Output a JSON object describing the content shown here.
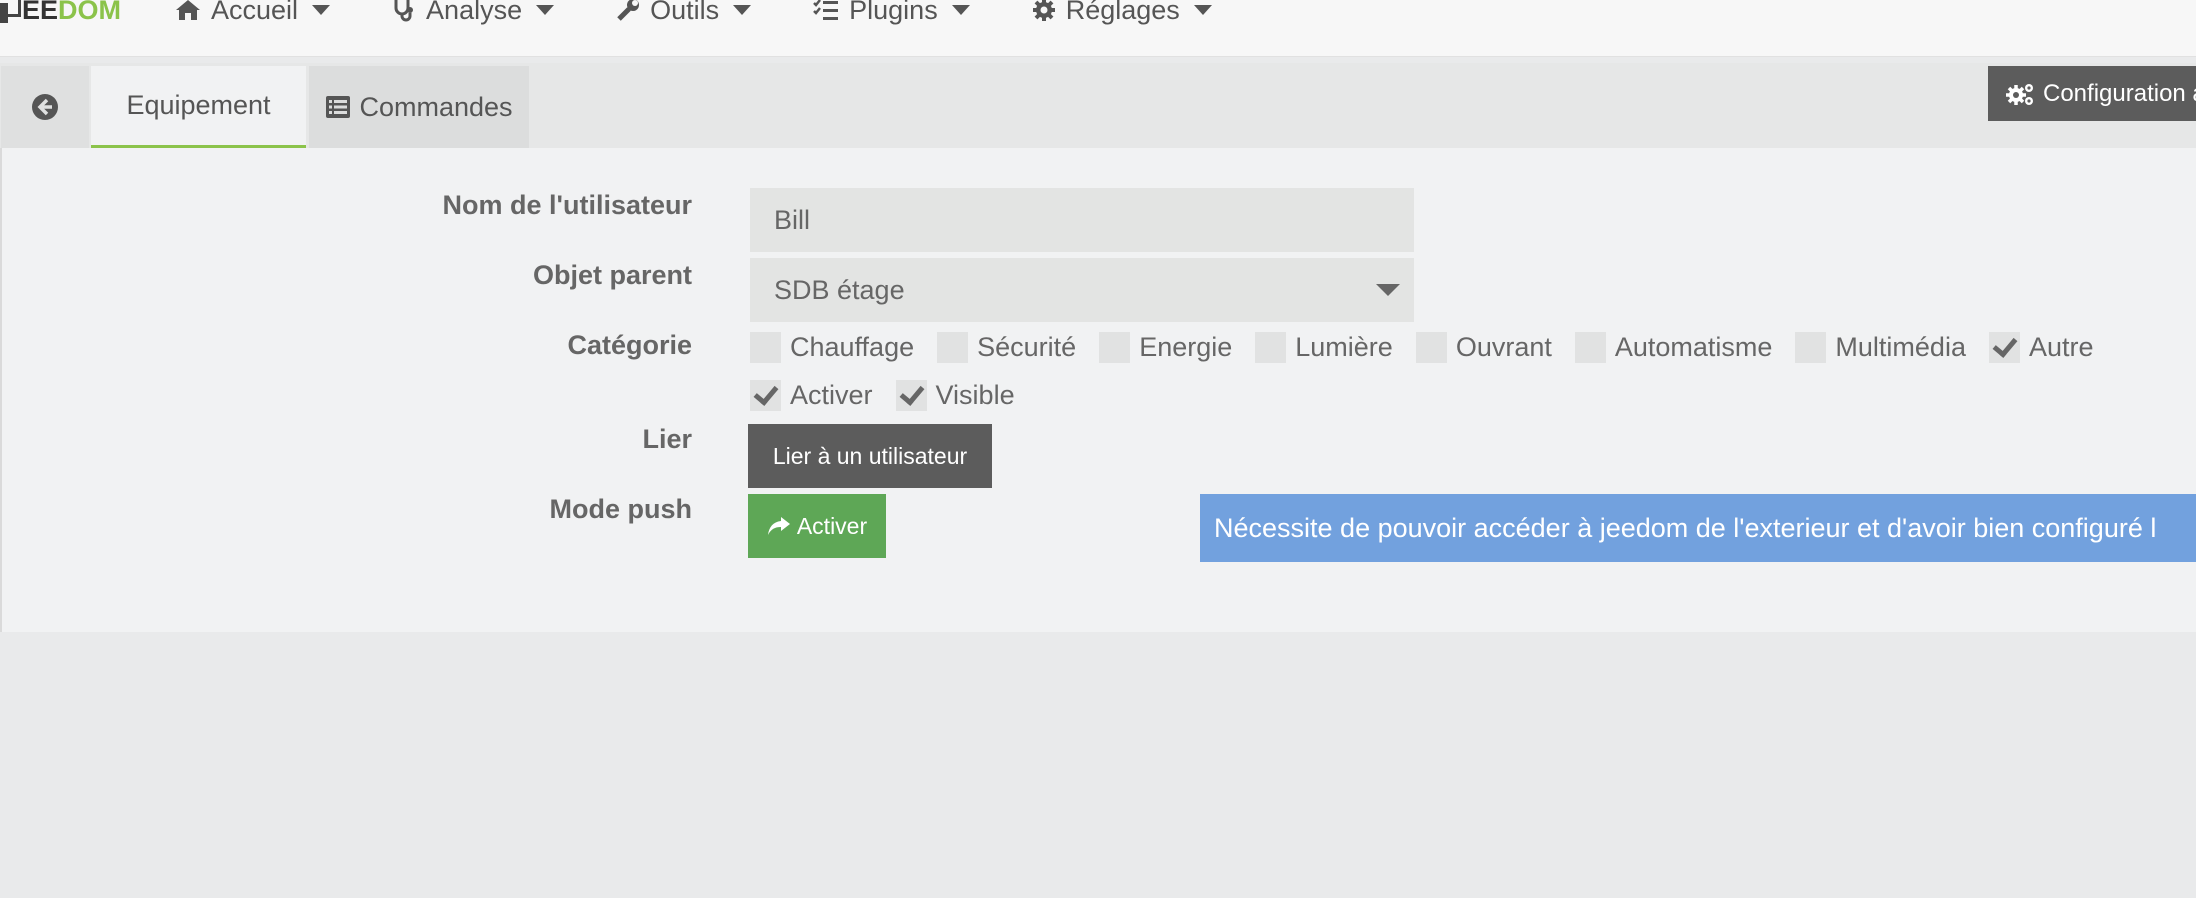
{
  "logo": {
    "prefix": "EE",
    "suffix": "DOM"
  },
  "nav": [
    {
      "label": "Accueil",
      "icon": "home-icon"
    },
    {
      "label": "Analyse",
      "icon": "stethoscope-icon"
    },
    {
      "label": "Outils",
      "icon": "wrench-icon"
    },
    {
      "label": "Plugins",
      "icon": "tasks-icon"
    },
    {
      "label": "Réglages",
      "icon": "gear-icon"
    }
  ],
  "config_button": {
    "label": "Configuration a"
  },
  "tabs": {
    "equipment": "Equipement",
    "commands": "Commandes"
  },
  "form": {
    "user_label": "Nom de l'utilisateur",
    "user_value": "Bill",
    "parent_label": "Objet parent",
    "parent_value": "SDB étage",
    "category_label": "Catégorie",
    "categories": [
      {
        "label": "Chauffage",
        "checked": false
      },
      {
        "label": "Sécurité",
        "checked": false
      },
      {
        "label": "Energie",
        "checked": false
      },
      {
        "label": "Lumière",
        "checked": false
      },
      {
        "label": "Ouvrant",
        "checked": false
      },
      {
        "label": "Automatisme",
        "checked": false
      },
      {
        "label": "Multimédia",
        "checked": false
      },
      {
        "label": "Autre",
        "checked": true
      }
    ],
    "options": [
      {
        "label": "Activer",
        "checked": true
      },
      {
        "label": "Visible",
        "checked": true
      }
    ],
    "link_label": "Lier",
    "link_button": "Lier à un utilisateur",
    "push_label": "Mode push",
    "push_button": "Activer",
    "push_alert": "Nécessite de pouvoir accéder à jeedom de l'exterieur et d'avoir bien configuré l"
  },
  "colors": {
    "accent": "#8bc34a",
    "success": "#5ea756",
    "info": "#72a1de",
    "dark": "#5c5c5c"
  }
}
